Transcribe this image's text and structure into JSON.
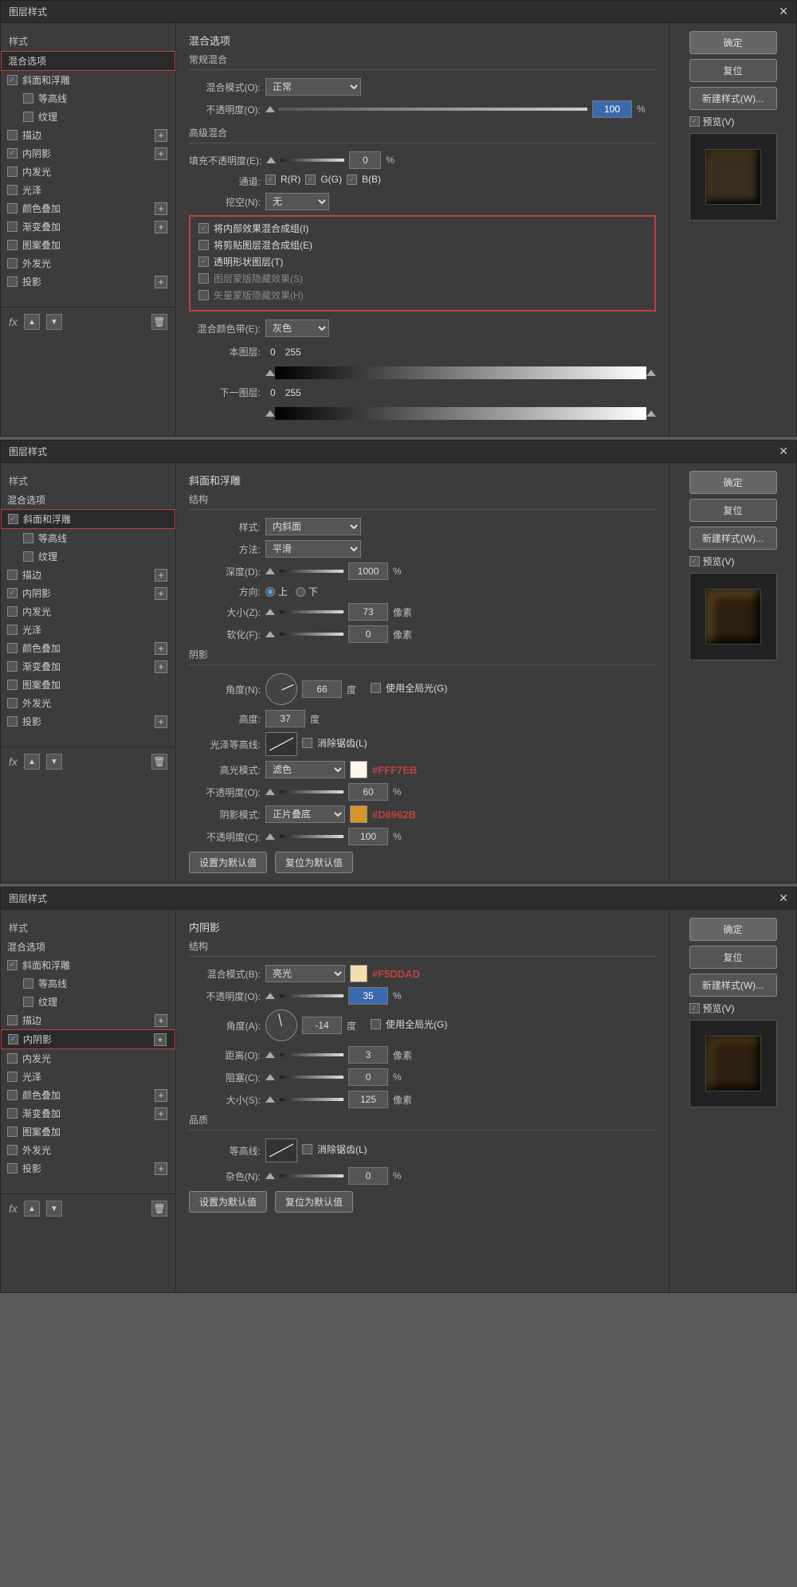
{
  "dialogs": [
    {
      "id": "dialog1",
      "title": "图层样式",
      "sidebar": {
        "section_label": "样式",
        "items": [
          {
            "label": "混合选项",
            "checked": false,
            "has_plus": false,
            "active": true,
            "selected": false
          },
          {
            "label": "斜面和浮雕",
            "checked": true,
            "has_plus": false,
            "active": false,
            "selected": false,
            "highlighted": true
          },
          {
            "label": "等高线",
            "checked": false,
            "has_plus": false,
            "active": false,
            "selected": false,
            "indent": true
          },
          {
            "label": "纹理",
            "checked": false,
            "has_plus": false,
            "active": false,
            "selected": false,
            "indent": true
          },
          {
            "label": "描边",
            "checked": false,
            "has_plus": true,
            "active": false,
            "selected": false
          },
          {
            "label": "内阴影",
            "checked": true,
            "has_plus": true,
            "active": false,
            "selected": false
          },
          {
            "label": "内发光",
            "checked": false,
            "has_plus": false,
            "active": false,
            "selected": false
          },
          {
            "label": "光泽",
            "checked": false,
            "has_plus": false,
            "active": false,
            "selected": false
          },
          {
            "label": "颜色叠加",
            "checked": false,
            "has_plus": true,
            "active": false,
            "selected": false
          },
          {
            "label": "渐变叠加",
            "checked": false,
            "has_plus": true,
            "active": false,
            "selected": false
          },
          {
            "label": "图案叠加",
            "checked": false,
            "has_plus": false,
            "active": false,
            "selected": false
          },
          {
            "label": "外发光",
            "checked": false,
            "has_plus": false,
            "active": false,
            "selected": false
          },
          {
            "label": "投影",
            "checked": false,
            "has_plus": true,
            "active": false,
            "selected": false
          }
        ]
      },
      "content_title": "混合选项",
      "buttons": {
        "ok": "确定",
        "reset": "复位",
        "new_style": "新建样式(W)...",
        "preview_label": "预览(V)"
      },
      "panel": {
        "normal_blend_title": "混合选项",
        "normal_blend_subtitle": "常规混合",
        "blend_mode_label": "混合模式(O):",
        "blend_mode_value": "正常",
        "opacity_label": "不透明度(O):",
        "opacity_value": "100",
        "opacity_unit": "%",
        "advanced_title": "高级混合",
        "fill_opacity_label": "填充不透明度(E):",
        "fill_opacity_value": "0",
        "fill_opacity_unit": "%",
        "channel_label": "通道:",
        "channel_r": "R(R)",
        "channel_g": "G(G)",
        "channel_b": "B(B)",
        "knockout_label": "挖空(N):",
        "knockout_value": "无",
        "cb1": "将内部效果混合成组(I)",
        "cb2": "将剪贴图层混合成组(E)",
        "cb3": "透明形状图层(T)",
        "cb4": "图层蒙版隐藏效果(S)",
        "cb5": "矢量蒙版隐藏效果(H)",
        "blend_color_label": "混合颜色带(E):",
        "blend_color_value": "灰色",
        "this_layer_label": "本图层:",
        "this_layer_min": "0",
        "this_layer_max": "255",
        "next_layer_label": "下一图层:",
        "next_layer_min": "0",
        "next_layer_max": "255"
      }
    },
    {
      "id": "dialog2",
      "title": "图层样式",
      "sidebar": {
        "section_label": "样式",
        "items": [
          {
            "label": "混合选项",
            "checked": false,
            "has_plus": false,
            "active": false,
            "selected": false
          },
          {
            "label": "斜面和浮雕",
            "checked": true,
            "has_plus": false,
            "active": true,
            "selected": false,
            "highlighted": true
          },
          {
            "label": "等高线",
            "checked": false,
            "has_plus": false,
            "active": false,
            "selected": false,
            "indent": true
          },
          {
            "label": "纹理",
            "checked": false,
            "has_plus": false,
            "active": false,
            "selected": false,
            "indent": true
          },
          {
            "label": "描边",
            "checked": false,
            "has_plus": true,
            "active": false,
            "selected": false
          },
          {
            "label": "内阴影",
            "checked": true,
            "has_plus": true,
            "active": false,
            "selected": false
          },
          {
            "label": "内发光",
            "checked": false,
            "has_plus": false,
            "active": false,
            "selected": false
          },
          {
            "label": "光泽",
            "checked": false,
            "has_plus": false,
            "active": false,
            "selected": false
          },
          {
            "label": "颜色叠加",
            "checked": false,
            "has_plus": true,
            "active": false,
            "selected": false
          },
          {
            "label": "渐变叠加",
            "checked": false,
            "has_plus": true,
            "active": false,
            "selected": false
          },
          {
            "label": "图案叠加",
            "checked": false,
            "has_plus": false,
            "active": false,
            "selected": false
          },
          {
            "label": "外发光",
            "checked": false,
            "has_plus": false,
            "active": false,
            "selected": false
          },
          {
            "label": "投影",
            "checked": false,
            "has_plus": true,
            "active": false,
            "selected": false
          }
        ]
      },
      "content_title": "斜面和浮雕",
      "content_subtitle": "结构",
      "buttons": {
        "ok": "确定",
        "reset": "复位",
        "new_style": "新建样式(W)...",
        "preview_label": "预览(V)"
      },
      "panel": {
        "style_label": "样式:",
        "style_value": "内斜面",
        "method_label": "方法:",
        "method_value": "平滑",
        "depth_label": "深度(D):",
        "depth_value": "1000",
        "depth_unit": "%",
        "direction_label": "方向:",
        "direction_up": "上",
        "direction_down": "下",
        "size_label": "大小(Z):",
        "size_value": "73",
        "size_unit": "像素",
        "soften_label": "软化(F):",
        "soften_value": "0",
        "soften_unit": "像素",
        "shadow_title": "阴影",
        "angle_label": "角度(N):",
        "angle_value": "66",
        "angle_unit": "度",
        "global_light": "使用全局光(G)",
        "altitude_label": "高度:",
        "altitude_value": "37",
        "altitude_unit": "度",
        "gloss_contour_label": "光泽等高线:",
        "anti_alias": "消除锯齿(L)",
        "highlight_mode_label": "高光模式:",
        "highlight_mode_value": "滤色",
        "highlight_color": "#FFF7EB",
        "highlight_opacity_label": "不透明度(O):",
        "highlight_opacity_value": "60",
        "highlight_opacity_unit": "%",
        "shadow_mode_label": "阴影模式:",
        "shadow_mode_value": "正片叠底",
        "shadow_color": "#D6962B",
        "shadow_opacity_label": "不透明度(C):",
        "shadow_opacity_value": "100",
        "shadow_opacity_unit": "%",
        "set_default": "设置为默认值",
        "reset_default": "复位为默认值"
      }
    },
    {
      "id": "dialog3",
      "title": "图层样式",
      "sidebar": {
        "section_label": "样式",
        "items": [
          {
            "label": "混合选项",
            "checked": false,
            "has_plus": false,
            "active": false,
            "selected": false
          },
          {
            "label": "斜面和浮雕",
            "checked": true,
            "has_plus": false,
            "active": false,
            "selected": false
          },
          {
            "label": "等高线",
            "checked": false,
            "has_plus": false,
            "active": false,
            "selected": false,
            "indent": true
          },
          {
            "label": "纹理",
            "checked": false,
            "has_plus": false,
            "active": false,
            "selected": false,
            "indent": true
          },
          {
            "label": "描边",
            "checked": false,
            "has_plus": true,
            "active": false,
            "selected": false
          },
          {
            "label": "内阴影",
            "checked": true,
            "has_plus": true,
            "active": true,
            "selected": false,
            "highlighted": true
          },
          {
            "label": "内发光",
            "checked": false,
            "has_plus": false,
            "active": false,
            "selected": false
          },
          {
            "label": "光泽",
            "checked": false,
            "has_plus": false,
            "active": false,
            "selected": false
          },
          {
            "label": "颜色叠加",
            "checked": false,
            "has_plus": true,
            "active": false,
            "selected": false
          },
          {
            "label": "渐变叠加",
            "checked": false,
            "has_plus": true,
            "active": false,
            "selected": false
          },
          {
            "label": "图案叠加",
            "checked": false,
            "has_plus": false,
            "active": false,
            "selected": false
          },
          {
            "label": "外发光",
            "checked": false,
            "has_plus": false,
            "active": false,
            "selected": false
          },
          {
            "label": "投影",
            "checked": false,
            "has_plus": true,
            "active": false,
            "selected": false
          }
        ]
      },
      "content_title": "内阴影",
      "content_subtitle": "结构",
      "buttons": {
        "ok": "确定",
        "reset": "复位",
        "new_style": "新建样式(W)...",
        "preview_label": "预览(V)"
      },
      "panel": {
        "blend_mode_label": "混合模式(B):",
        "blend_mode_value": "亮光",
        "blend_color": "#F5DDAD",
        "opacity_label": "不透明度(O):",
        "opacity_value": "35",
        "opacity_unit": "%",
        "angle_label": "角度(A):",
        "angle_value": "-14",
        "angle_unit": "度",
        "use_global_light": "使用全局光(G)",
        "distance_label": "距离(O):",
        "distance_value": "3",
        "distance_unit": "像素",
        "choke_label": "阻塞(C):",
        "choke_value": "0",
        "choke_unit": "%",
        "size_label": "大小(S):",
        "size_value": "125",
        "size_unit": "像素",
        "quality_title": "品质",
        "contour_label": "等高线:",
        "anti_alias": "消除锯齿(L)",
        "noise_label": "杂色(N):",
        "noise_value": "0",
        "noise_unit": "%",
        "set_default": "设置为默认值",
        "reset_default": "复位为默认值"
      }
    }
  ]
}
